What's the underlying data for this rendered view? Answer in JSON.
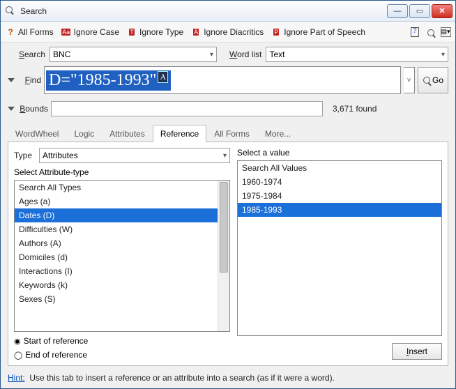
{
  "title": "Search",
  "toolbar": {
    "all_forms": "All Forms",
    "ignore_case": "Ignore Case",
    "ignore_type": "Ignore Type",
    "ignore_diacritics": "Ignore Diacritics",
    "ignore_pos": "Ignore Part of Speech"
  },
  "search": {
    "label": "Search",
    "value": "BNC",
    "wordlist_label": "Word list",
    "wordlist_value": "Text"
  },
  "find": {
    "label": "Find",
    "expr": "D=\"1985-1993\"",
    "sup": "A",
    "go": "Go"
  },
  "bounds": {
    "label": "Bounds",
    "value": "",
    "found": "3,671 found"
  },
  "tabs": [
    "WordWheel",
    "Logic",
    "Attributes",
    "Reference",
    "All Forms",
    "More..."
  ],
  "active_tab": 3,
  "type": {
    "label": "Type",
    "value": "Attributes"
  },
  "attribute_label": "Select Attribute-type",
  "attribute_types": [
    "Search All Types",
    "Ages (a)",
    "Dates (D)",
    "Difficulties (W)",
    "Authors (A)",
    "Domiciles (d)",
    "Interactions (I)",
    "Keywords (k)",
    "Sexes (S)"
  ],
  "attribute_selected": 2,
  "value_label": "Select a value",
  "values": [
    "Search All Values",
    "1960-1974",
    "1975-1984",
    "1985-1993"
  ],
  "value_selected": 3,
  "radios": {
    "start": "Start of reference",
    "end": "End of reference"
  },
  "insert": "Insert",
  "hint_label": "Hint:",
  "hint_text": "Use this tab to insert a reference or an attribute into a search (as if it were a word)."
}
